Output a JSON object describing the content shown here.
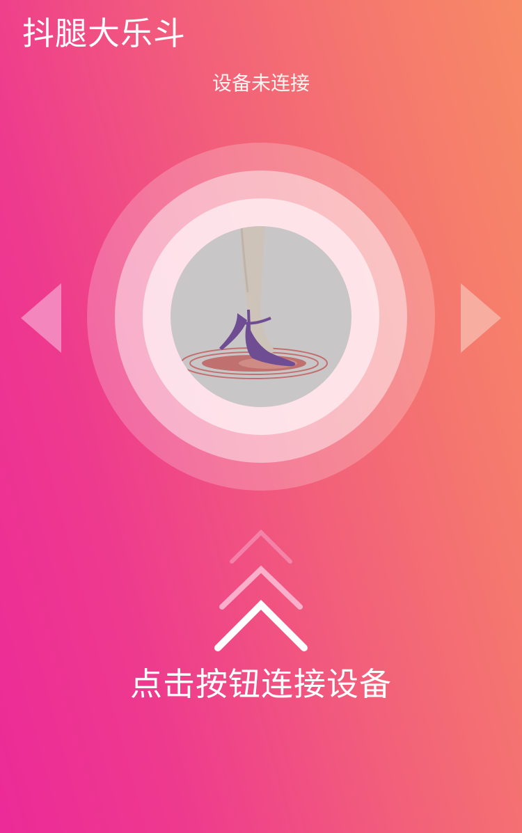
{
  "header": {
    "title": "抖腿大乐斗"
  },
  "device": {
    "status_text": "设备未连接",
    "image_icon": "high-heel-tapping-icon"
  },
  "navigation": {
    "prev_icon": "triangle-left-icon",
    "next_icon": "triangle-right-icon"
  },
  "connect": {
    "chevron_icon": "chevron-up-icon",
    "label": "点击按钮连接设备"
  },
  "colors": {
    "gradient_start": "#ec2a98",
    "gradient_end": "#f78a66",
    "text": "#ffffff",
    "shoe": "#6f4d93",
    "disc": "#c9c6c7"
  }
}
